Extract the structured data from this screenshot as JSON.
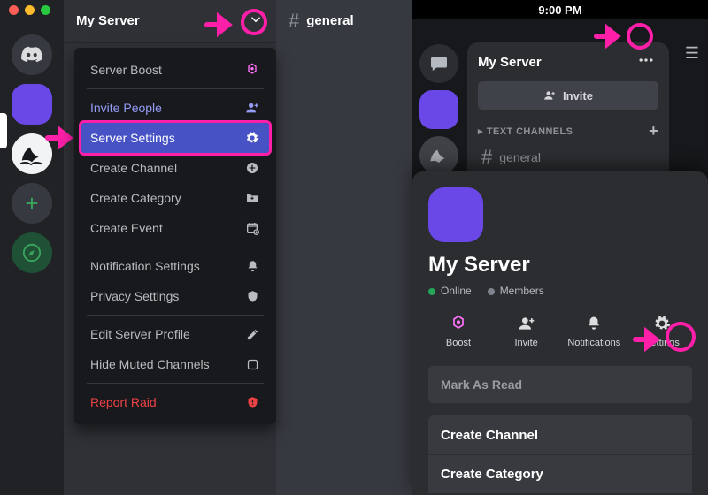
{
  "desktop": {
    "traffic_colors": [
      "#ff5f57",
      "#febc2e",
      "#28c840"
    ],
    "server_name": "My Server",
    "channel": "general",
    "menu": {
      "boost": "Server Boost",
      "invite": "Invite People",
      "settings": "Server Settings",
      "create_channel": "Create Channel",
      "create_category": "Create Category",
      "create_event": "Create Event",
      "notifications": "Notification Settings",
      "privacy": "Privacy Settings",
      "edit_profile": "Edit Server Profile",
      "hide_muted": "Hide Muted Channels",
      "report": "Report Raid"
    }
  },
  "mobile": {
    "time": "9:00 PM",
    "server_name": "My Server",
    "invite_label": "Invite",
    "section_label": "TEXT CHANNELS",
    "channel": "general",
    "sheet_title": "My Server",
    "online_label": "Online",
    "members_label": "Members",
    "actions": {
      "boost": "Boost",
      "invite": "Invite",
      "notifications": "Notifications",
      "settings": "Settings"
    },
    "mark_read": "Mark As Read",
    "rows": [
      "Create Channel",
      "Create Category"
    ]
  },
  "colors": {
    "highlight": "#ff1fa9"
  }
}
